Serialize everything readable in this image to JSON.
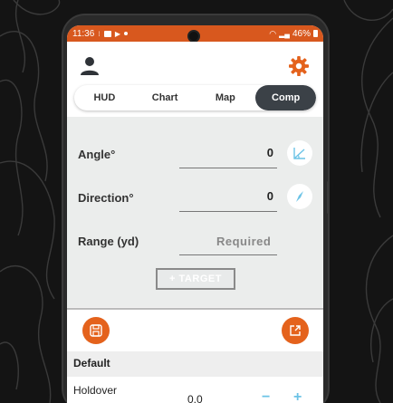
{
  "status_bar": {
    "time": "11:36",
    "battery": "46%"
  },
  "tabs": [
    {
      "label": "HUD"
    },
    {
      "label": "Chart"
    },
    {
      "label": "Map"
    },
    {
      "label": "Comp"
    }
  ],
  "active_tab": "Comp",
  "form": {
    "angle": {
      "label": "Angle°",
      "value": "0"
    },
    "direction": {
      "label": "Direction°",
      "value": "0"
    },
    "range": {
      "label": "Range (yd)",
      "placeholder": "Required"
    },
    "target_button": "+ TARGET"
  },
  "profile": {
    "section_title": "Default",
    "holdover_label": "Holdover",
    "holdover_value": "0.0"
  },
  "icons": {
    "avatar": "person-icon",
    "settings": "gear-icon",
    "angle": "angle-icon",
    "direction": "compass-icon",
    "save": "save-icon",
    "share": "share-icon"
  },
  "colors": {
    "accent": "#e4621c",
    "statusbar": "#d8581e",
    "active_tab": "#3b4147",
    "stepper": "#6cc3e6"
  }
}
